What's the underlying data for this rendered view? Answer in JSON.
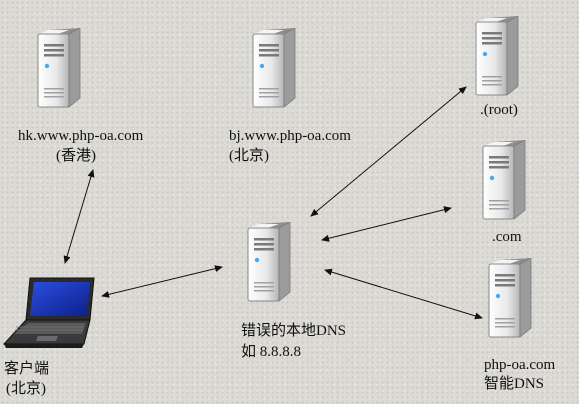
{
  "nodes": {
    "hk": {
      "name": "hk.www.php-oa.com",
      "location": "(香港)",
      "icon": "server-icon"
    },
    "bj": {
      "name": "bj.www.php-oa.com",
      "location": "(北京)",
      "icon": "server-icon"
    },
    "root": {
      "name": ".(root)",
      "icon": "server-icon"
    },
    "com": {
      "name": ".com",
      "icon": "server-icon"
    },
    "local_dns": {
      "name": "错误的本地DNS",
      "address": "如 8.8.8.8",
      "icon": "server-icon"
    },
    "smart_dns": {
      "name": "php-oa.com",
      "type": "智能DNS",
      "icon": "server-icon"
    },
    "client": {
      "name": "客户端",
      "location": "(北京)",
      "icon": "laptop-icon"
    }
  },
  "edges": [
    {
      "from": "client",
      "to": "hk",
      "direction": "both"
    },
    {
      "from": "client",
      "to": "local_dns",
      "direction": "both"
    },
    {
      "from": "local_dns",
      "to": "root",
      "direction": "both"
    },
    {
      "from": "local_dns",
      "to": "com",
      "direction": "both"
    },
    {
      "from": "local_dns",
      "to": "smart_dns",
      "direction": "both"
    }
  ],
  "colors": {
    "background": "#dcdad4",
    "line": "#111111",
    "screen": "#1e3cc8"
  }
}
